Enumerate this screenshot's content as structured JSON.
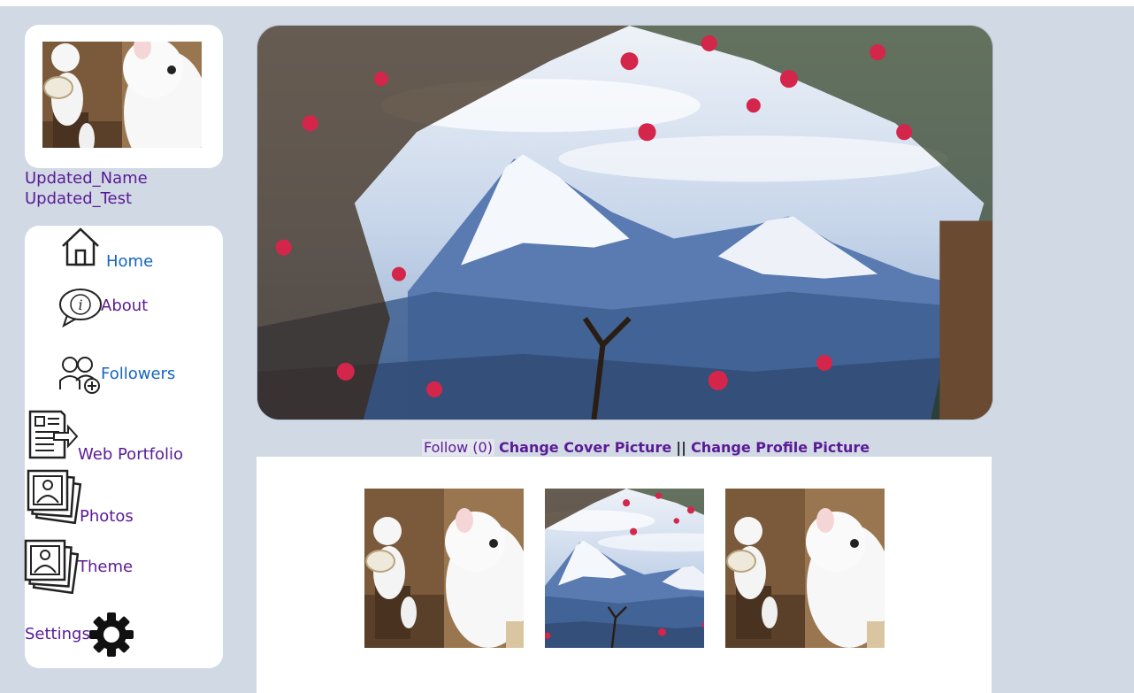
{
  "profile": {
    "name": "Updated_Name",
    "subtitle": "Updated_Test",
    "avatar_icon": "white-cat-photo"
  },
  "nav": {
    "items": [
      {
        "label": "Home",
        "icon": "house-icon"
      },
      {
        "label": "About",
        "icon": "info-bubble-icon"
      },
      {
        "label": "Followers",
        "icon": "followers-icon"
      },
      {
        "label": "Web Portfolio",
        "icon": "document-arrow-icon"
      },
      {
        "label": "Photos",
        "icon": "photo-stack-icon"
      },
      {
        "label": "Theme",
        "icon": "photo-stack-icon"
      },
      {
        "label": "Settings",
        "icon": "gear-icon"
      }
    ]
  },
  "actions": {
    "follow": "Follow (0)",
    "change_cover": "Change Cover Picture",
    "separator": "||",
    "change_profile": "Change Profile Picture"
  },
  "gallery": {
    "photos": [
      "white-cat",
      "mountain",
      "white-cat"
    ]
  },
  "colors": {
    "background": "#d1d9e4",
    "link_purple": "#5a1a96",
    "link_blue": "#1565c0",
    "panel": "#ffffff"
  }
}
